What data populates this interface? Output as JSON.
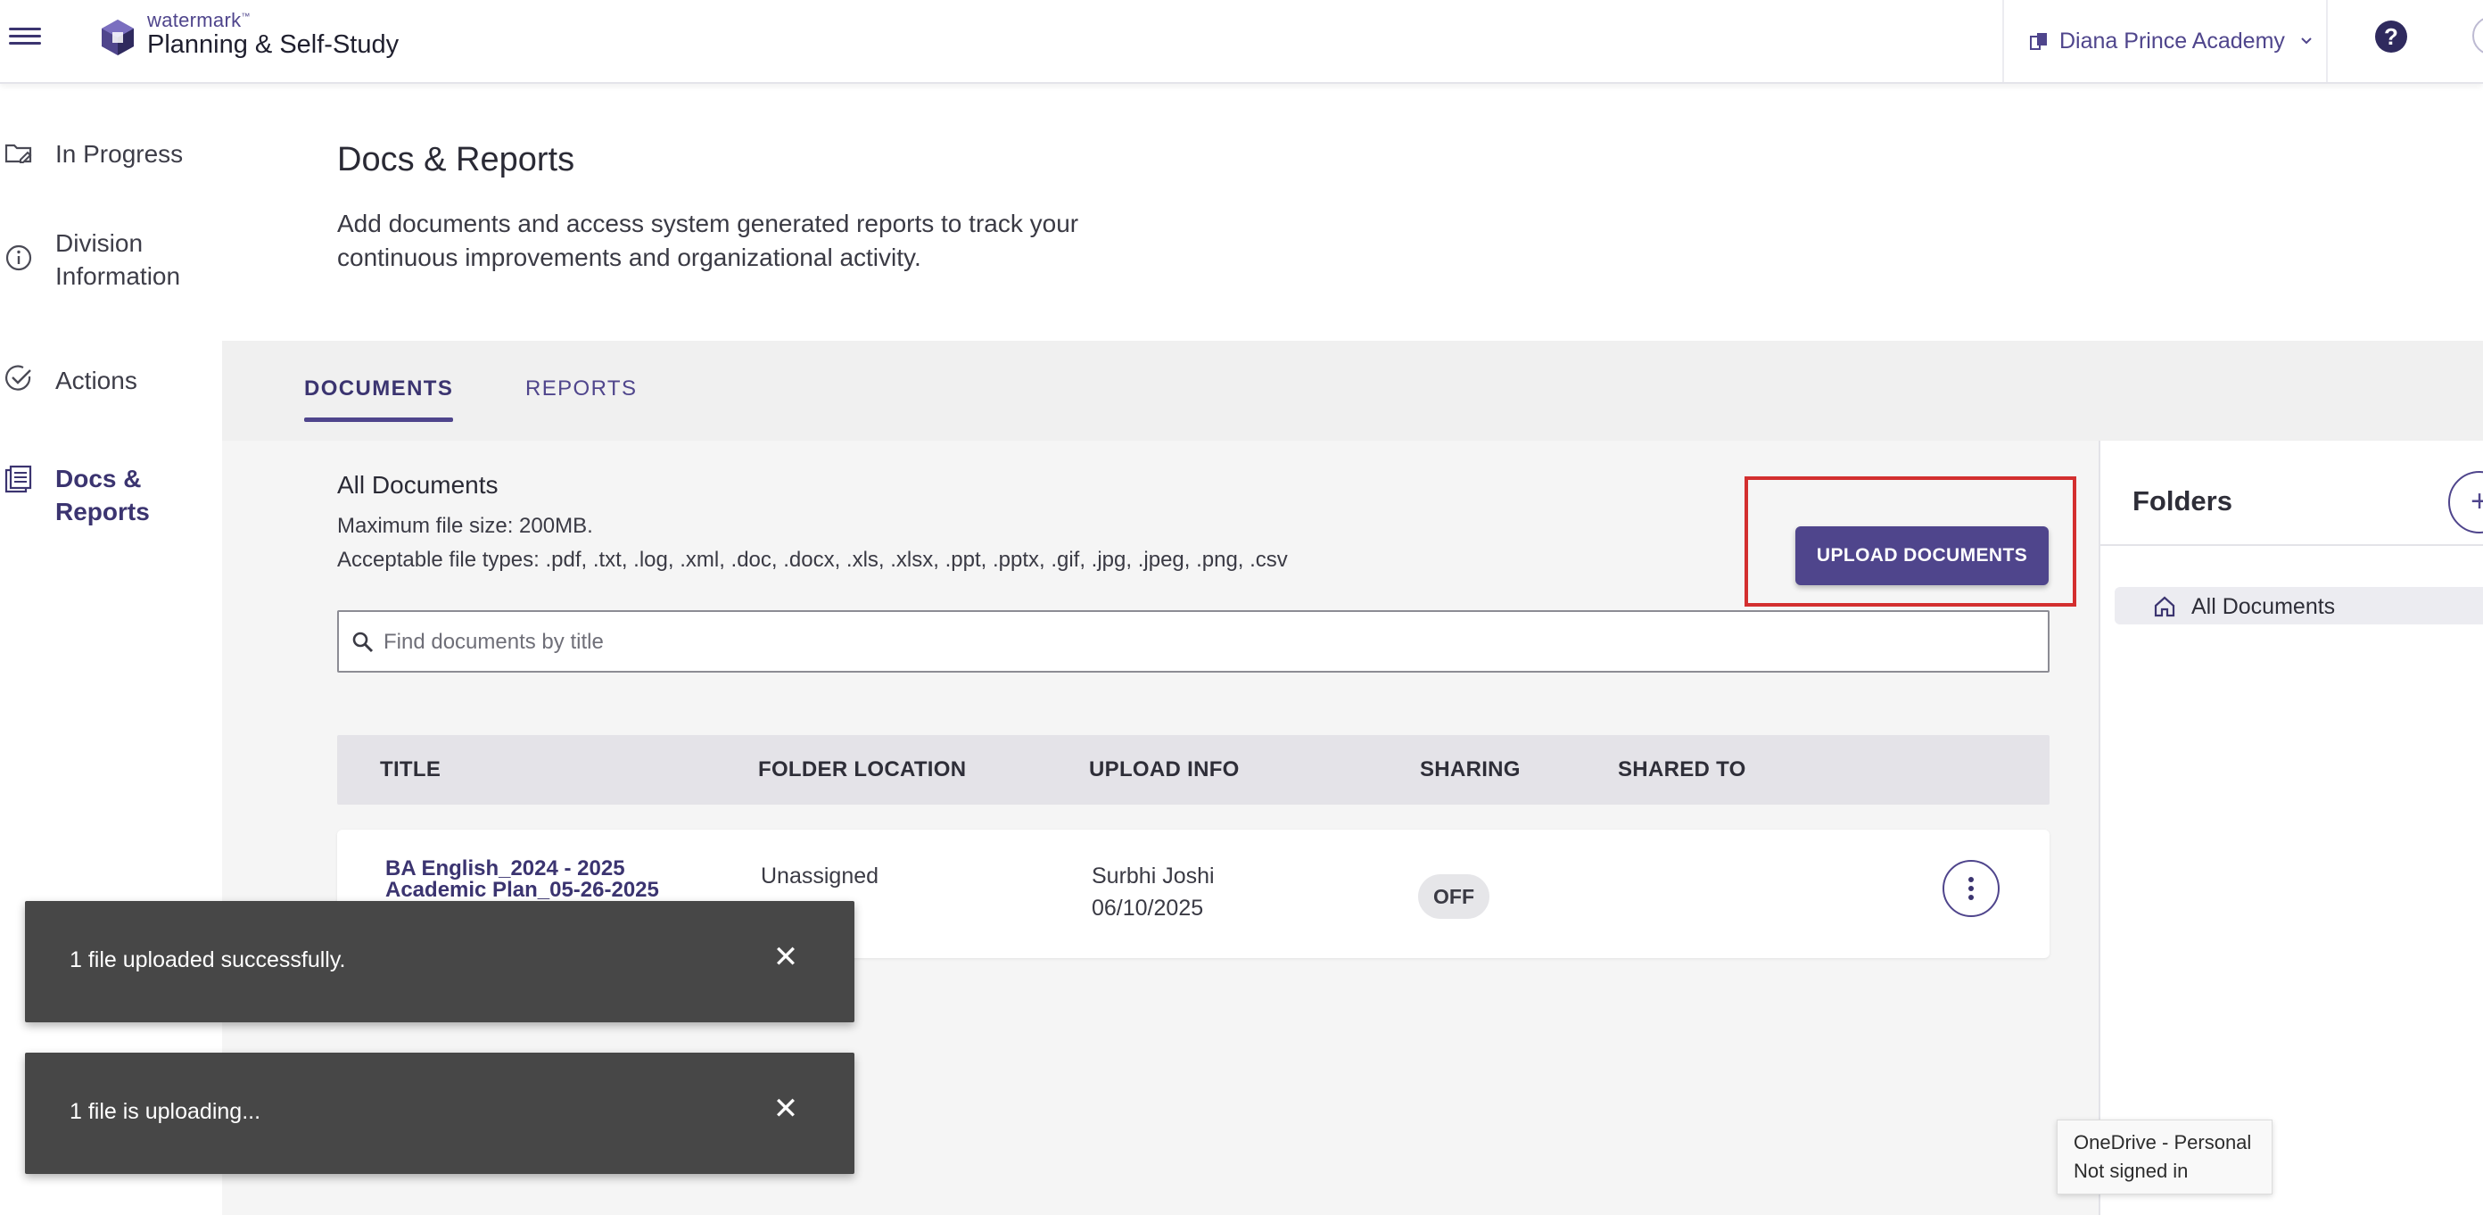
{
  "app": {
    "brand_small": "watermark",
    "brand_tm": "™",
    "brand_title": "Planning & Self-Study",
    "institution": "Diana Prince Academy",
    "help_symbol": "?"
  },
  "sidebar": {
    "items": [
      {
        "label_lines": [
          "In Progress"
        ],
        "icon": "folder-edit-icon",
        "active": false
      },
      {
        "label_lines": [
          "Division",
          "Information"
        ],
        "icon": "info-circle-icon",
        "active": false
      },
      {
        "label_lines": [
          "Actions"
        ],
        "icon": "check-circle-icon",
        "active": false
      },
      {
        "label_lines": [
          "Docs &",
          "Reports"
        ],
        "icon": "documents-icon",
        "active": true
      }
    ]
  },
  "page": {
    "title": "Docs & Reports",
    "description": "Add documents and access system generated reports to track your continuous improvements and organizational activity."
  },
  "tabs": [
    {
      "label": "DOCUMENTS",
      "active": true
    },
    {
      "label": "REPORTS",
      "active": false
    }
  ],
  "documents": {
    "section_title": "All Documents",
    "max_file_size": "Maximum file size: 200MB.",
    "file_types": "Acceptable file types: .pdf, .txt, .log, .xml, .doc, .docx, .xls, .xlsx, .ppt, .pptx, .gif, .jpg, .jpeg, .png, .csv",
    "upload_label": "UPLOAD DOCUMENTS",
    "search_placeholder": "Find documents by title",
    "columns": [
      "TITLE",
      "FOLDER LOCATION",
      "UPLOAD INFO",
      "SHARING",
      "SHARED TO"
    ],
    "rows": [
      {
        "title": "BA English_2024 - 2025 Academic Plan_05-26-2025",
        "folder": "Unassigned",
        "uploader": "Surbhi Joshi",
        "date": "06/10/2025",
        "sharing": "OFF",
        "shared_to": ""
      }
    ]
  },
  "folders": {
    "title": "Folders",
    "add_symbol": "+",
    "items": [
      {
        "label": "All Documents",
        "icon": "home-icon"
      }
    ]
  },
  "toasts": [
    {
      "message": "1 file uploaded successfully.",
      "close": "✕"
    },
    {
      "message": "1 file is uploading...",
      "close": "✕"
    }
  ],
  "tooltip": {
    "line1": "OneDrive - Personal",
    "line2": "Not signed in"
  },
  "colors": {
    "accent": "#4f458c",
    "highlight_border": "#d32f2f",
    "toast_bg": "#474747"
  }
}
